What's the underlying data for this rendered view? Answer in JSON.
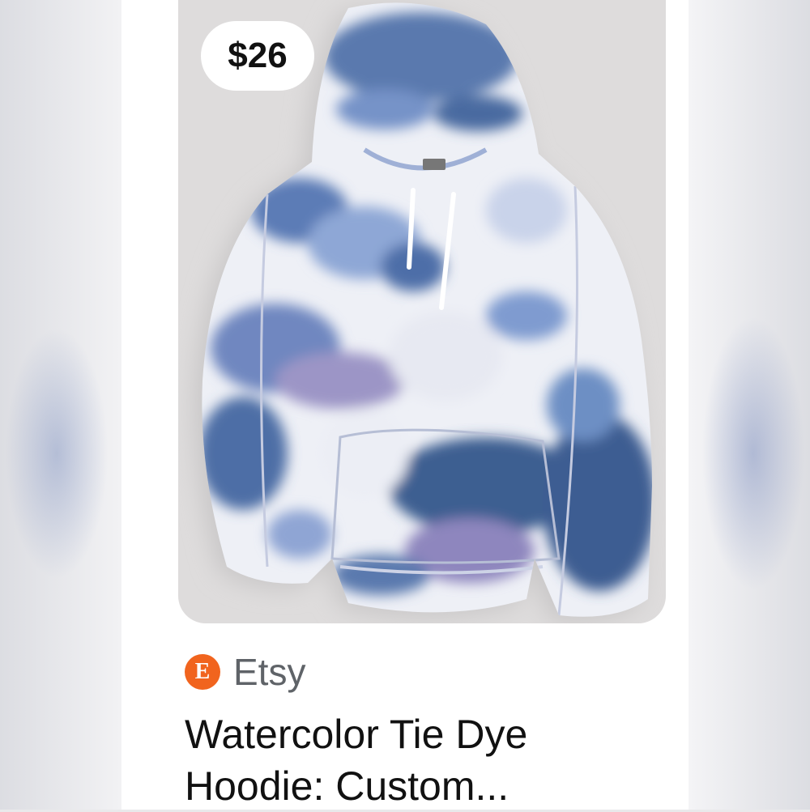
{
  "product": {
    "price": "$26",
    "source": "Etsy",
    "source_logo_letter": "E",
    "title": "Watercolor Tie Dye Hoodie: Custom...",
    "image_alt": "tie-dye hoodie photo",
    "colors": {
      "source_logo": "#f1641e",
      "dye_navy": "#3e5f91",
      "dye_blue": "#6d8fc4",
      "dye_lavender": "#9a93c4",
      "fabric_white": "#f1f2f7"
    }
  }
}
